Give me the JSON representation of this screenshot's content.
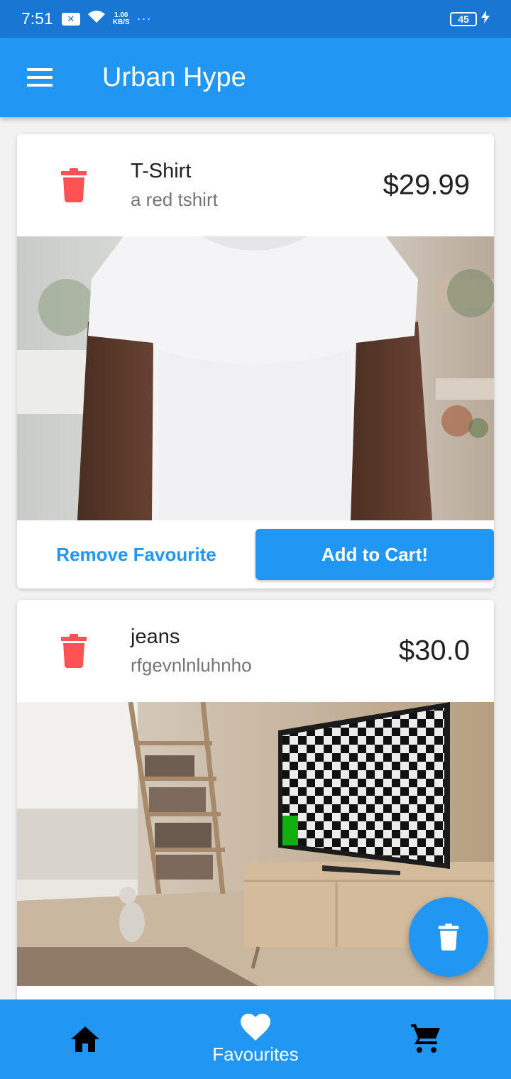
{
  "status_bar": {
    "time": "7:51",
    "speed_top": "1.00",
    "speed_bottom": "KB/S",
    "dots": "···",
    "battery": "45"
  },
  "app_bar": {
    "title": "Urban Hype",
    "menu_icon": "hamburger-menu-icon"
  },
  "colors": {
    "primary": "#2196f3",
    "status_bar": "#1976d2",
    "delete_red": "#ff5252"
  },
  "favourites": [
    {
      "title": "T-Shirt",
      "description": "a red tshirt",
      "price": "$29.99",
      "image": "white t-shirt photo",
      "remove_label": "Remove Favourite",
      "cart_label": "Add to Cart!"
    },
    {
      "title": "jeans",
      "description": "rfgevnlnluhnho",
      "price": "$30.0",
      "image": "living room with tv photo"
    }
  ],
  "fab": {
    "icon": "trash-icon"
  },
  "bottom_nav": {
    "items": [
      {
        "icon": "home-icon",
        "label": ""
      },
      {
        "icon": "heart-icon",
        "label": "Favourites"
      },
      {
        "icon": "cart-icon",
        "label": ""
      }
    ]
  }
}
